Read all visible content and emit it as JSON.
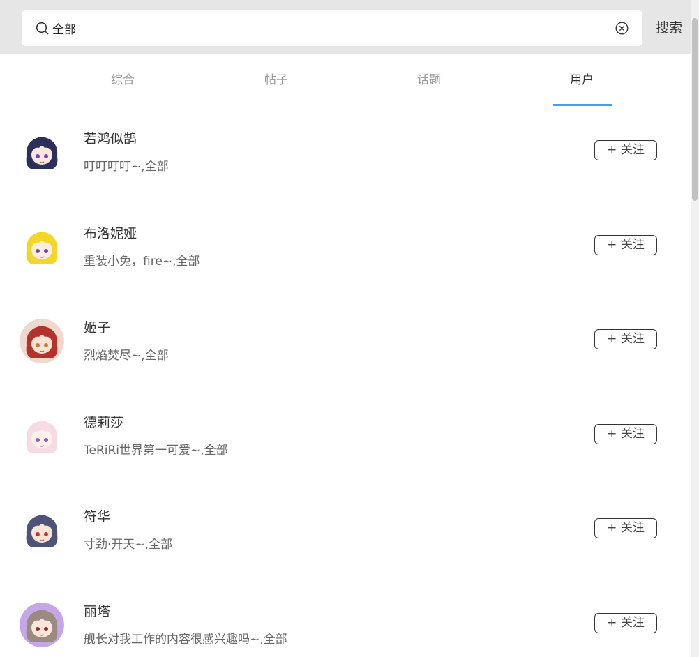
{
  "search": {
    "value": "全部",
    "button_label": "搜索",
    "search_icon": "search-icon",
    "clear_icon": "clear-icon"
  },
  "tabs": [
    {
      "label": "综合",
      "active": false
    },
    {
      "label": "帖子",
      "active": false
    },
    {
      "label": "话题",
      "active": false
    },
    {
      "label": "用户",
      "active": true
    }
  ],
  "colors": {
    "header_bg": "#e6e6e6",
    "active_tab_indicator": "#4a9ded",
    "text_primary": "#333333",
    "text_secondary": "#666666",
    "tab_inactive": "#999999"
  },
  "users": [
    {
      "name": "若鸿似鹄",
      "description": "叮叮叮叮~,全部",
      "follow_label": "+ 关注",
      "avatar_hair": "#2c2f5a",
      "avatar_skin": "#fbe7de",
      "avatar_bg": "#ffffff",
      "avatar_eye": "#7b3fa4"
    },
    {
      "name": "布洛妮娅",
      "description": "重装小兔，fire~,全部",
      "follow_label": "+ 关注",
      "avatar_hair": "#f2d72a",
      "avatar_skin": "#fdecdf",
      "avatar_bg": "#ffffff",
      "avatar_eye": "#6a4aa2"
    },
    {
      "name": "姬子",
      "description": "烈焰焚尽~,全部",
      "follow_label": "+ 关注",
      "avatar_hair": "#b4322c",
      "avatar_skin": "#fbe2d2",
      "avatar_bg": "#efd9cf",
      "avatar_eye": "#c47a3c"
    },
    {
      "name": "德莉莎",
      "description": "TeRiRi世界第一可爱~,全部",
      "follow_label": "+ 关注",
      "avatar_hair": "#f6dbe4",
      "avatar_skin": "#fff1ea",
      "avatar_bg": "#ffffff",
      "avatar_eye": "#8a5fb8"
    },
    {
      "name": "符华",
      "description": "寸劲·开天~,全部",
      "follow_label": "+ 关注",
      "avatar_hair": "#4e5479",
      "avatar_skin": "#f9e4d7",
      "avatar_bg": "#ffffff",
      "avatar_eye": "#c2322b"
    },
    {
      "name": "丽塔",
      "description": "舰长对我工作的内容很感兴趣吗~,全部",
      "follow_label": "+ 关注",
      "avatar_hair": "#9a8a80",
      "avatar_skin": "#fbe6db",
      "avatar_bg": "#c6a6e6",
      "avatar_eye": "#8a2c32"
    }
  ]
}
